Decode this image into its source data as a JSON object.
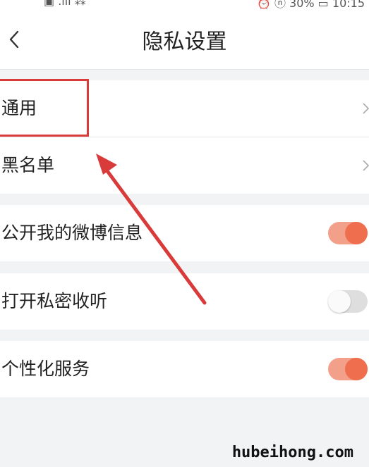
{
  "status_bar": {
    "left_icons": "▣ .ıll ⁂",
    "right_text": "⏰ ⓝ 30% ▭ 10:15"
  },
  "header": {
    "title": "隐私设置"
  },
  "settings": [
    {
      "label": "通用",
      "type": "link"
    },
    {
      "label": "黑名单",
      "type": "link"
    },
    {
      "label": "公开我的微博信息",
      "type": "toggle",
      "on": true
    },
    {
      "label": "打开私密收听",
      "type": "toggle",
      "on": false
    },
    {
      "label": "个性化服务",
      "type": "toggle",
      "on": true
    }
  ],
  "icons": {
    "back": "back-chevron-icon",
    "chevron": "chevron-right-icon"
  },
  "colors": {
    "accent": "#ef6e4d",
    "annotation": "#d93a3a"
  },
  "watermark": "hubeihong.com"
}
